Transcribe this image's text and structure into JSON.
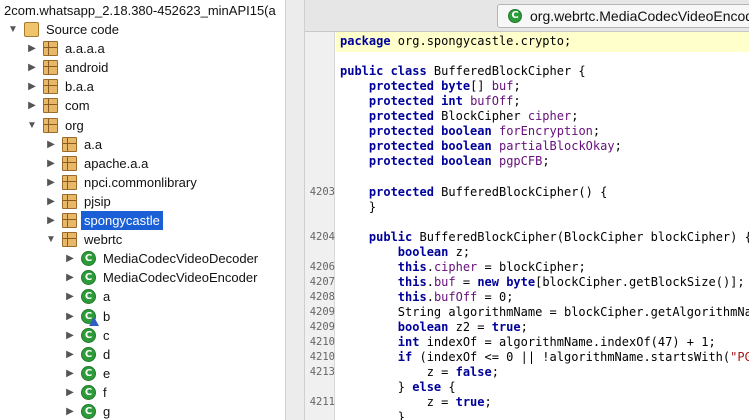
{
  "tree": {
    "title": "2com.whatsapp_2.18.380-452623_minAPI15(a",
    "items": [
      {
        "label": "Source code",
        "icon": "source-folder-icon",
        "indent": 0,
        "toggle": "expanded"
      },
      {
        "label": "a.a.a.a",
        "icon": "package-icon",
        "indent": 1,
        "toggle": "collapsed"
      },
      {
        "label": "android",
        "icon": "package-icon",
        "indent": 1,
        "toggle": "collapsed"
      },
      {
        "label": "b.a.a",
        "icon": "package-icon",
        "indent": 1,
        "toggle": "collapsed"
      },
      {
        "label": "com",
        "icon": "package-icon",
        "indent": 1,
        "toggle": "collapsed"
      },
      {
        "label": "org",
        "icon": "package-icon",
        "indent": 1,
        "toggle": "expanded"
      },
      {
        "label": "a.a",
        "icon": "package-icon",
        "indent": 2,
        "toggle": "collapsed"
      },
      {
        "label": "apache.a.a",
        "icon": "package-icon",
        "indent": 2,
        "toggle": "collapsed"
      },
      {
        "label": "npci.commonlibrary",
        "icon": "package-icon",
        "indent": 2,
        "toggle": "collapsed"
      },
      {
        "label": "pjsip",
        "icon": "package-icon",
        "indent": 2,
        "toggle": "collapsed"
      },
      {
        "label": "spongycastle",
        "icon": "package-icon",
        "indent": 2,
        "toggle": "collapsed",
        "selected": true
      },
      {
        "label": "webrtc",
        "icon": "package-icon",
        "indent": 2,
        "toggle": "expanded"
      },
      {
        "label": "MediaCodecVideoDecoder",
        "icon": "class-icon",
        "indent": 3,
        "toggle": "collapsed"
      },
      {
        "label": "MediaCodecVideoEncoder",
        "icon": "class-icon",
        "indent": 3,
        "toggle": "collapsed"
      },
      {
        "label": "a",
        "icon": "class-icon",
        "indent": 3,
        "toggle": "collapsed"
      },
      {
        "label": "b",
        "icon": "class-warning-icon",
        "indent": 3,
        "toggle": "collapsed"
      },
      {
        "label": "c",
        "icon": "class-icon",
        "indent": 3,
        "toggle": "collapsed"
      },
      {
        "label": "d",
        "icon": "class-icon",
        "indent": 3,
        "toggle": "collapsed"
      },
      {
        "label": "e",
        "icon": "class-icon",
        "indent": 3,
        "toggle": "collapsed"
      },
      {
        "label": "f",
        "icon": "class-icon",
        "indent": 3,
        "toggle": "collapsed"
      },
      {
        "label": "g",
        "icon": "class-icon",
        "indent": 3,
        "toggle": "collapsed"
      }
    ]
  },
  "editor": {
    "tab_label": "org.webrtc.MediaCodecVideoEncod",
    "tab_icon": "class-icon",
    "class_icon_letter": "C",
    "lines": [
      {
        "num": "",
        "tokens": [
          {
            "t": "package",
            "c": "kw"
          },
          {
            "t": " org.spongycastle.crypto;"
          }
        ]
      },
      {
        "num": "",
        "tokens": []
      },
      {
        "num": "",
        "tokens": [
          {
            "t": "public class",
            "c": "kw"
          },
          {
            "t": " BufferedBlockCipher {"
          }
        ]
      },
      {
        "num": "",
        "tokens": [
          {
            "t": "    "
          },
          {
            "t": "protected byte",
            "c": "kw"
          },
          {
            "t": "[] "
          },
          {
            "t": "buf",
            "c": "fld"
          },
          {
            "t": ";"
          }
        ]
      },
      {
        "num": "",
        "tokens": [
          {
            "t": "    "
          },
          {
            "t": "protected int",
            "c": "kw"
          },
          {
            "t": " "
          },
          {
            "t": "bufOff",
            "c": "fld"
          },
          {
            "t": ";"
          }
        ]
      },
      {
        "num": "",
        "tokens": [
          {
            "t": "    "
          },
          {
            "t": "protected",
            "c": "kw"
          },
          {
            "t": " BlockCipher "
          },
          {
            "t": "cipher",
            "c": "fld"
          },
          {
            "t": ";"
          }
        ]
      },
      {
        "num": "",
        "tokens": [
          {
            "t": "    "
          },
          {
            "t": "protected boolean",
            "c": "kw"
          },
          {
            "t": " "
          },
          {
            "t": "forEncryption",
            "c": "fld"
          },
          {
            "t": ";"
          }
        ]
      },
      {
        "num": "",
        "tokens": [
          {
            "t": "    "
          },
          {
            "t": "protected boolean",
            "c": "kw"
          },
          {
            "t": " "
          },
          {
            "t": "partialBlockOkay",
            "c": "fld"
          },
          {
            "t": ";"
          }
        ]
      },
      {
        "num": "",
        "tokens": [
          {
            "t": "    "
          },
          {
            "t": "protected boolean",
            "c": "kw"
          },
          {
            "t": " "
          },
          {
            "t": "pgpCFB",
            "c": "fld"
          },
          {
            "t": ";"
          }
        ]
      },
      {
        "num": "",
        "tokens": []
      },
      {
        "num": "4203",
        "tokens": [
          {
            "t": "    "
          },
          {
            "t": "protected",
            "c": "kw"
          },
          {
            "t": " BufferedBlockCipher() {"
          }
        ]
      },
      {
        "num": "",
        "tokens": [
          {
            "t": "    }"
          }
        ]
      },
      {
        "num": "",
        "tokens": []
      },
      {
        "num": "4204",
        "tokens": [
          {
            "t": "    "
          },
          {
            "t": "public",
            "c": "kw"
          },
          {
            "t": " BufferedBlockCipher(BlockCipher blockCipher) {"
          }
        ]
      },
      {
        "num": "",
        "tokens": [
          {
            "t": "        "
          },
          {
            "t": "boolean",
            "c": "kw"
          },
          {
            "t": " z;"
          }
        ]
      },
      {
        "num": "4206",
        "tokens": [
          {
            "t": "        "
          },
          {
            "t": "this",
            "c": "kw"
          },
          {
            "t": "."
          },
          {
            "t": "cipher",
            "c": "fld"
          },
          {
            "t": " = blockCipher;"
          }
        ]
      },
      {
        "num": "4207",
        "tokens": [
          {
            "t": "        "
          },
          {
            "t": "this",
            "c": "kw"
          },
          {
            "t": "."
          },
          {
            "t": "buf",
            "c": "fld"
          },
          {
            "t": " = "
          },
          {
            "t": "new byte",
            "c": "kw"
          },
          {
            "t": "[blockCipher.getBlockSize()];"
          }
        ]
      },
      {
        "num": "4208",
        "tokens": [
          {
            "t": "        "
          },
          {
            "t": "this",
            "c": "kw"
          },
          {
            "t": "."
          },
          {
            "t": "bufOff",
            "c": "fld"
          },
          {
            "t": " = 0;"
          }
        ]
      },
      {
        "num": "4209",
        "tokens": [
          {
            "t": "        String algorithmName = blockCipher.getAlgorithmName"
          }
        ]
      },
      {
        "num": "4209",
        "tokens": [
          {
            "t": "        "
          },
          {
            "t": "boolean",
            "c": "kw"
          },
          {
            "t": " z2 = "
          },
          {
            "t": "true",
            "c": "kw"
          },
          {
            "t": ";"
          }
        ]
      },
      {
        "num": "4210",
        "tokens": [
          {
            "t": "        "
          },
          {
            "t": "int",
            "c": "kw"
          },
          {
            "t": " indexOf = algorithmName.indexOf(47) + 1;"
          }
        ]
      },
      {
        "num": "4210",
        "tokens": [
          {
            "t": "        "
          },
          {
            "t": "if",
            "c": "kw"
          },
          {
            "t": " (indexOf <= 0 || !algorithmName.startsWith("
          },
          {
            "t": "\"PGP\"",
            "c": "str"
          }
        ]
      },
      {
        "num": "4213",
        "tokens": [
          {
            "t": "            z = "
          },
          {
            "t": "false",
            "c": "kw"
          },
          {
            "t": ";"
          }
        ]
      },
      {
        "num": "",
        "tokens": [
          {
            "t": "        } "
          },
          {
            "t": "else",
            "c": "kw"
          },
          {
            "t": " {"
          }
        ]
      },
      {
        "num": "4211",
        "tokens": [
          {
            "t": "            z = "
          },
          {
            "t": "true",
            "c": "kw"
          },
          {
            "t": ";"
          }
        ]
      },
      {
        "num": "",
        "tokens": [
          {
            "t": "        }"
          }
        ]
      }
    ]
  }
}
